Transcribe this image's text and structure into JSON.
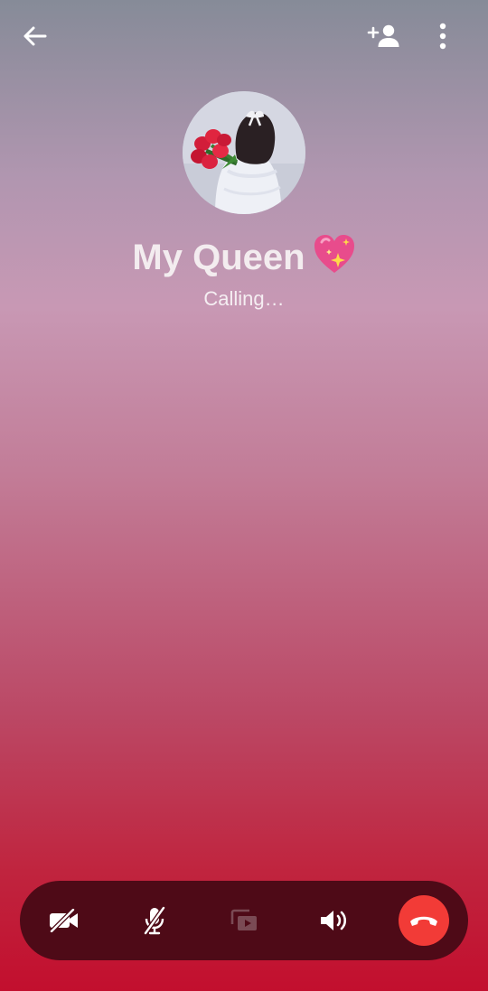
{
  "contact": {
    "name": "My Queen",
    "status": "Calling…"
  },
  "top_bar": {
    "icons": [
      "back-arrow-icon",
      "add-person-icon",
      "more-vert-icon"
    ]
  },
  "controls": [
    {
      "name": "video-off",
      "icon": "video-off-icon",
      "enabled": true
    },
    {
      "name": "mute",
      "icon": "mic-off-icon",
      "enabled": true
    },
    {
      "name": "screen-share",
      "icon": "screen-share-icon",
      "enabled": false
    },
    {
      "name": "speaker",
      "icon": "speaker-icon",
      "enabled": true
    },
    {
      "name": "end-call",
      "icon": "phone-hangup-icon",
      "enabled": true
    }
  ],
  "colors": {
    "control_bar": "#4e0a17",
    "end_call": "#f23b37",
    "icon": "#ffffff",
    "icon_disabled": "#7a4a54"
  }
}
